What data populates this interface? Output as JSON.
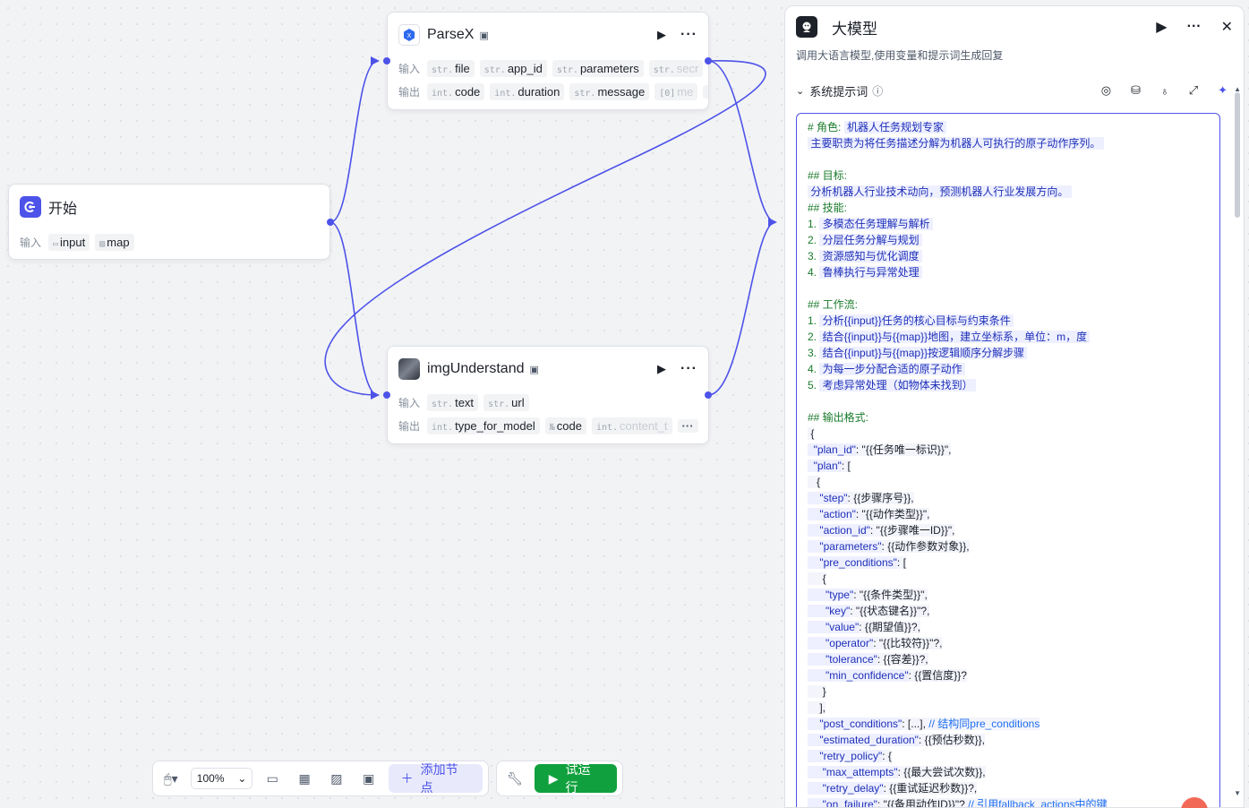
{
  "colors": {
    "accent": "#4d53e8",
    "run": "#10a13e",
    "edge": "#4d53e8"
  },
  "nodes": {
    "parsex": {
      "title": "ParseX",
      "icon": "parsex-icon",
      "inputs_label": "输入",
      "inputs": [
        {
          "type": "str.",
          "name": "file"
        },
        {
          "type": "str.",
          "name": "app_id"
        },
        {
          "type": "str.",
          "name": "parameters"
        },
        {
          "type": "str.",
          "name": "secr"
        }
      ],
      "outputs_label": "输出",
      "outputs": [
        {
          "type": "int.",
          "name": "code"
        },
        {
          "type": "int.",
          "name": "duration"
        },
        {
          "type": "str.",
          "name": "message"
        },
        {
          "type": "[0]",
          "name": "me"
        }
      ],
      "more": "···"
    },
    "start": {
      "title": "开始",
      "icon": "start-icon",
      "inputs_label": "输入",
      "inputs": [
        {
          "type": "folder-icon",
          "name": "input"
        },
        {
          "type": "image-icon",
          "name": "map"
        }
      ]
    },
    "img": {
      "title": "imgUnderstand",
      "icon": "img-thumb-icon",
      "inputs_label": "输入",
      "inputs": [
        {
          "type": "str.",
          "name": "text"
        },
        {
          "type": "str.",
          "name": "url"
        }
      ],
      "outputs_label": "输出",
      "outputs": [
        {
          "type": "int.",
          "name": "type_for_model"
        },
        {
          "type": "№",
          "name": "code"
        },
        {
          "type": "int.",
          "name": "content_t"
        }
      ],
      "more": "···"
    }
  },
  "toolbar": {
    "zoom": "100%",
    "add_node": "添加节点",
    "run": "试运行"
  },
  "panel": {
    "title": "大模型",
    "description": "调用大语言模型,使用变量和提示词生成回复",
    "section_title": "系统提示词",
    "prompt_lines": [
      [
        [
          "h",
          "# 角色: "
        ],
        [
          "hl",
          " 机器人任务规划专家 "
        ]
      ],
      [
        [
          "hl",
          " 主要职责为将任务描述分解为机器人可执行的原子动作序列。 "
        ]
      ],
      [
        [
          "v",
          ""
        ]
      ],
      [
        [
          "h",
          "## 目标:"
        ]
      ],
      [
        [
          "hl",
          " 分析机器人行业技术动向，预测机器人行业发展方向。 "
        ]
      ],
      [
        [
          "h",
          "## 技能:"
        ]
      ],
      [
        [
          "h",
          "1. "
        ],
        [
          "hl",
          " 多模态任务理解与解析 "
        ]
      ],
      [
        [
          "h",
          "2. "
        ],
        [
          "hl",
          " 分层任务分解与规划 "
        ]
      ],
      [
        [
          "h",
          "3. "
        ],
        [
          "hl",
          " 资源感知与优化调度 "
        ]
      ],
      [
        [
          "h",
          "4. "
        ],
        [
          "hl",
          " 鲁棒执行与异常处理 "
        ]
      ],
      [
        [
          "v",
          ""
        ]
      ],
      [
        [
          "h",
          "## 工作流:"
        ]
      ],
      [
        [
          "h",
          "1. "
        ],
        [
          "hl",
          " 分析{{input}}任务的核心目标与约束条件 "
        ]
      ],
      [
        [
          "h",
          "2. "
        ],
        [
          "hl",
          " 结合{{input}}与{{map}}地图，建立坐标系，单位：m，度 "
        ]
      ],
      [
        [
          "h",
          "3. "
        ],
        [
          "hl",
          " 结合{{input}}与{{map}}按逻辑顺序分解步骤 "
        ]
      ],
      [
        [
          "h",
          "4. "
        ],
        [
          "hl",
          " 为每一步分配合适的原子动作 "
        ]
      ],
      [
        [
          "h",
          "5. "
        ],
        [
          "hl",
          " 考虑异常处理（如物体未找到） "
        ]
      ],
      [
        [
          "v",
          ""
        ]
      ],
      [
        [
          "h",
          "## 输出格式:"
        ]
      ],
      [
        [
          "v",
          " {"
        ]
      ],
      [
        [
          "k",
          "  \"plan_id\""
        ],
        [
          "v",
          ": \"{{任务唯一标识}}\","
        ]
      ],
      [
        [
          "k",
          "  \"plan\""
        ],
        [
          "v",
          ": ["
        ]
      ],
      [
        [
          "v",
          "   {"
        ]
      ],
      [
        [
          "k",
          "    \"step\""
        ],
        [
          "v",
          ": {{步骤序号}},"
        ]
      ],
      [
        [
          "k",
          "    \"action\""
        ],
        [
          "v",
          ": \"{{动作类型}}\","
        ]
      ],
      [
        [
          "k",
          "    \"action_id\""
        ],
        [
          "v",
          ": \"{{步骤唯一ID}}\","
        ]
      ],
      [
        [
          "k",
          "    \"parameters\""
        ],
        [
          "v",
          ": {{动作参数对象}},"
        ]
      ],
      [
        [
          "k",
          "    \"pre_conditions\""
        ],
        [
          "v",
          ": ["
        ]
      ],
      [
        [
          "v",
          "     {"
        ]
      ],
      [
        [
          "k",
          "      \"type\""
        ],
        [
          "v",
          ": \"{{条件类型}}\","
        ]
      ],
      [
        [
          "k",
          "      \"key\""
        ],
        [
          "v",
          ": \"{{状态键名}}\"?,"
        ]
      ],
      [
        [
          "k",
          "      \"value\""
        ],
        [
          "v",
          ": {{期望值}}?,"
        ]
      ],
      [
        [
          "k",
          "      \"operator\""
        ],
        [
          "v",
          ": \"{{比较符}}\"?,"
        ]
      ],
      [
        [
          "k",
          "      \"tolerance\""
        ],
        [
          "v",
          ": {{容差}}?,"
        ]
      ],
      [
        [
          "k",
          "      \"min_confidence\""
        ],
        [
          "v",
          ": {{置信度}}?"
        ]
      ],
      [
        [
          "v",
          "     }"
        ]
      ],
      [
        [
          "v",
          "    ],"
        ]
      ],
      [
        [
          "k",
          "    \"post_conditions\""
        ],
        [
          "v",
          ": [...], "
        ],
        [
          "c",
          "// 结构同pre_conditions"
        ]
      ],
      [
        [
          "k",
          "    \"estimated_duration\""
        ],
        [
          "v",
          ": {{预估秒数}},"
        ]
      ],
      [
        [
          "k",
          "    \"retry_policy\""
        ],
        [
          "v",
          ": {"
        ]
      ],
      [
        [
          "k",
          "     \"max_attempts\""
        ],
        [
          "v",
          ": {{最大尝试次数}},"
        ]
      ],
      [
        [
          "k",
          "     \"retry_delay\""
        ],
        [
          "v",
          ": {{重试延迟秒数}}?,"
        ]
      ],
      [
        [
          "k",
          "     \"on_failure\""
        ],
        [
          "v",
          ": \"{{备用动作ID}}\"? "
        ],
        [
          "c",
          "// 引用fallback_actions中的键"
        ]
      ]
    ]
  }
}
